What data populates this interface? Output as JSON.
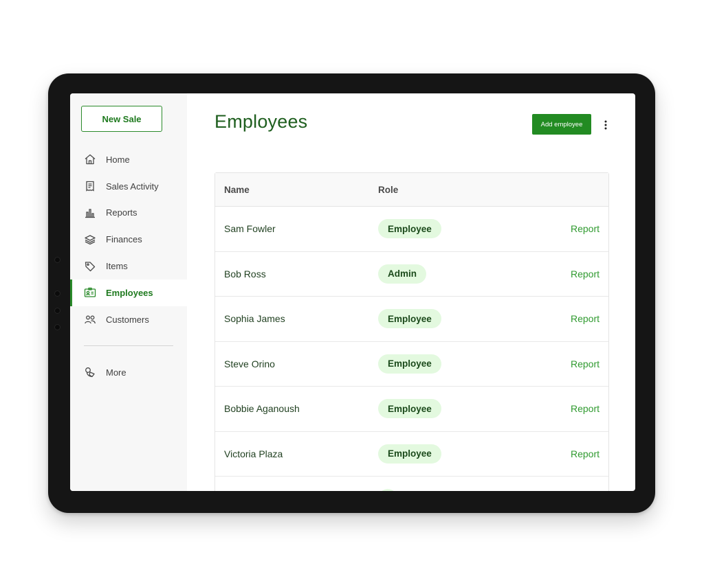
{
  "sidebar": {
    "new_sale_label": "New Sale",
    "items": [
      {
        "label": "Home",
        "icon": "home-icon"
      },
      {
        "label": "Sales Activity",
        "icon": "receipt-icon"
      },
      {
        "label": "Reports",
        "icon": "bar-chart-icon"
      },
      {
        "label": "Finances",
        "icon": "layers-icon"
      },
      {
        "label": "Items",
        "icon": "tag-icon"
      },
      {
        "label": "Employees",
        "icon": "id-card-icon",
        "active": true
      },
      {
        "label": "Customers",
        "icon": "people-icon"
      }
    ],
    "more_label": "More"
  },
  "main": {
    "title": "Employees",
    "add_button_label": "Add employee",
    "table": {
      "headers": {
        "name": "Name",
        "role": "Role"
      },
      "rows": [
        {
          "name": "Sam Fowler",
          "role": "Employee",
          "action": "Report"
        },
        {
          "name": "Bob Ross",
          "role": "Admin",
          "action": "Report"
        },
        {
          "name": "Sophia James",
          "role": "Employee",
          "action": "Report"
        },
        {
          "name": "Steve Orino",
          "role": "Employee",
          "action": "Report"
        },
        {
          "name": "Bobbie Aganoush",
          "role": "Employee",
          "action": "Report"
        },
        {
          "name": "Victoria Plaza",
          "role": "Employee",
          "action": "Report"
        }
      ]
    }
  },
  "colors": {
    "accent": "#228b22",
    "title": "#1e5e1e",
    "badge_bg": "#e3f9df",
    "frame": "#151515"
  }
}
